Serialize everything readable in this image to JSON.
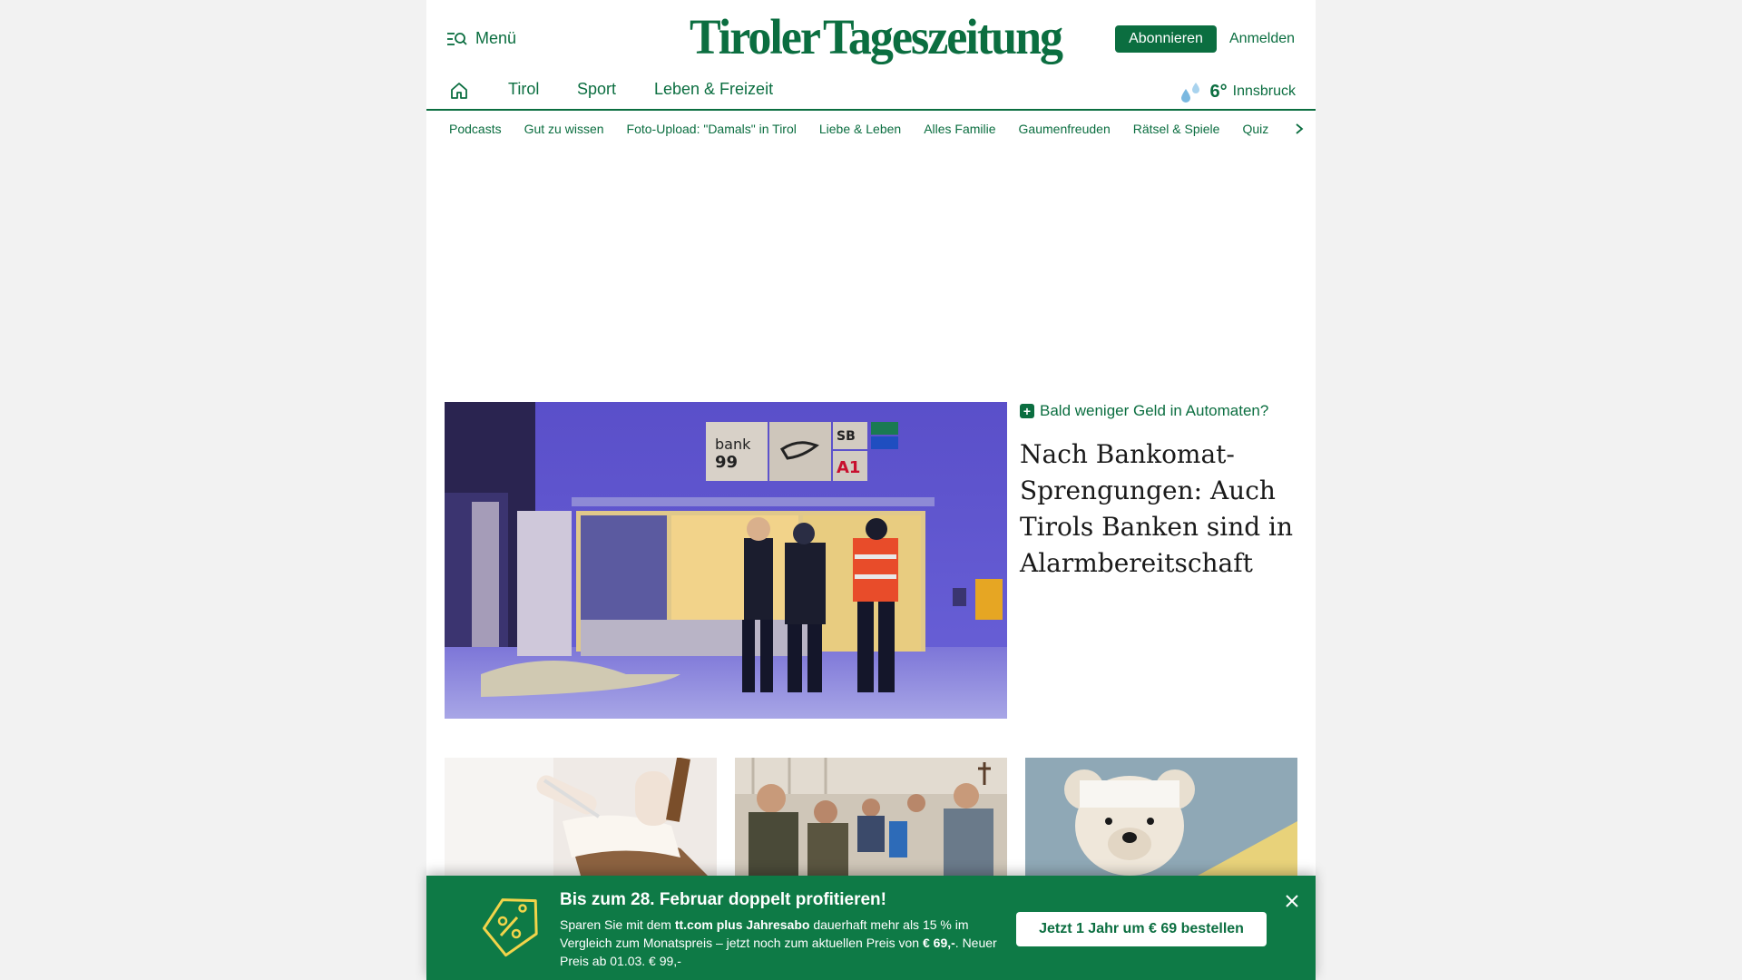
{
  "header": {
    "menu_label": "Menü",
    "logo_left": "Tiroler",
    "logo_right": "Tageszeitung",
    "subscribe_label": "Abonnieren",
    "login_label": "Anmelden"
  },
  "main_nav": {
    "items": [
      "Tirol",
      "Sport",
      "Leben & Freizeit"
    ],
    "weather": {
      "temperature": "6°",
      "city": "Innsbruck",
      "icon": "rain-drops-icon"
    }
  },
  "sub_nav": {
    "items": [
      "Podcasts",
      "Gut zu wissen",
      "Foto-Upload: \"Damals\" in Tirol",
      "Liebe & Leben",
      "Alles Familie",
      "Gaumenfreuden",
      "Rätsel & Spiele",
      "Quiz"
    ]
  },
  "lead_story": {
    "kicker": "Bald weniger Geld in Automaten?",
    "headline": "Nach Bankomat-Sprengungen: Auch Tirols Banken sind in Alarmbereitschaft",
    "sign_bank": "bank",
    "sign_99": "99",
    "sign_sb": "SB",
    "sign_a1": "A1"
  },
  "promo": {
    "title": "Bis zum 28. Februar doppelt profitieren!",
    "body_1": "Sparen Sie mit dem ",
    "body_bold_1": "tt.com plus Jahresabo",
    "body_2": " dauerhaft mehr als 15 % im Vergleich zum Monatspreis – jetzt noch zum aktuellen Preis von ",
    "body_bold_2": "€ 69,-",
    "body_3": ". Neuer Preis ab 01.03. € 99,-",
    "cta_label": "Jetzt 1 Jahr um € 69 bestellen"
  },
  "colors": {
    "brand_green": "#0b6e40",
    "promo_green": "#0e7a46"
  }
}
